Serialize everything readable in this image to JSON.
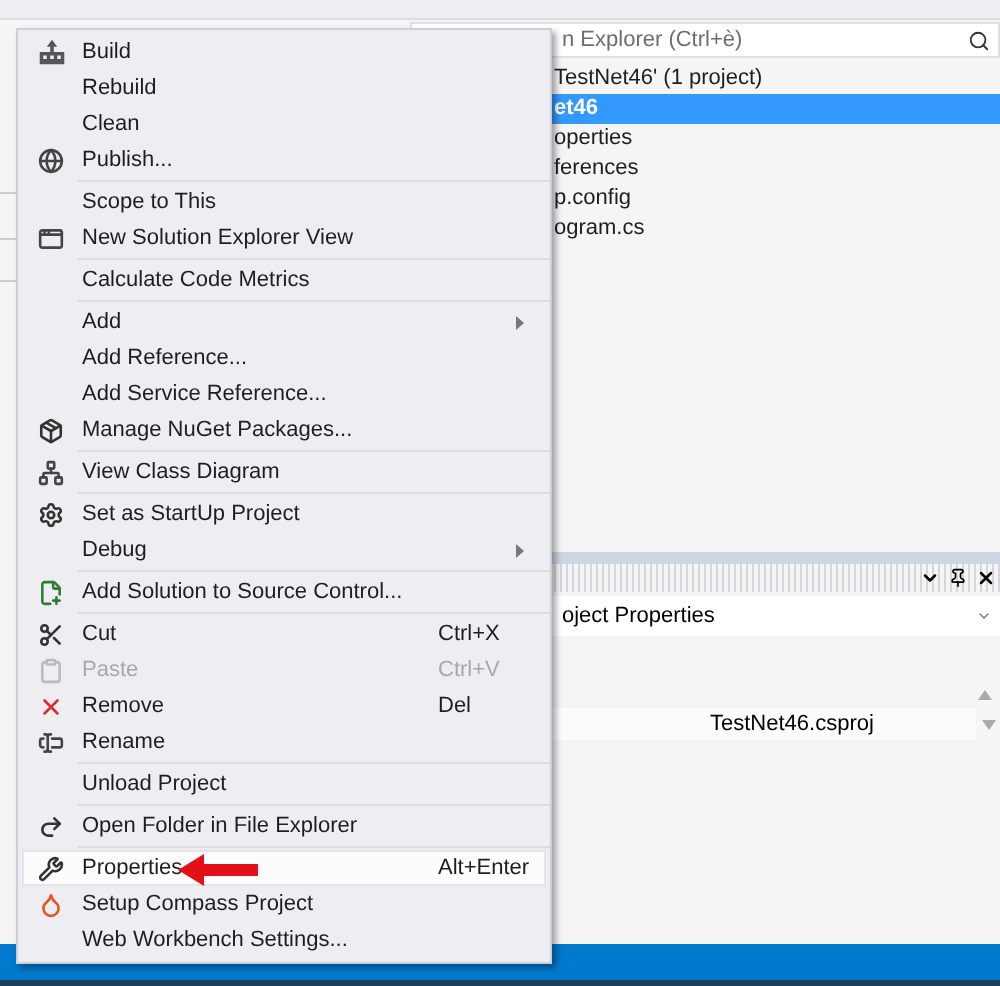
{
  "solution_explorer": {
    "search": {
      "placeholder": "n Explorer (Ctrl+è)"
    },
    "tree": [
      {
        "label": "TestNet46' (1 project)",
        "selected": false
      },
      {
        "label": "et46",
        "selected": true
      },
      {
        "label": "operties",
        "selected": false
      },
      {
        "label": "ferences",
        "selected": false
      },
      {
        "label": "p.config",
        "selected": false
      },
      {
        "label": "ogram.cs",
        "selected": false
      }
    ]
  },
  "properties_panel": {
    "object": "oject Properties",
    "rows": [
      {
        "value": "TestNet46.csproj"
      }
    ]
  },
  "context_menu": {
    "groups": [
      [
        {
          "label": "Build",
          "selected": false,
          "disabled": false,
          "submenu": false
        },
        {
          "label": "Rebuild",
          "selected": false,
          "disabled": false,
          "submenu": false
        },
        {
          "label": "Clean",
          "selected": false,
          "disabled": false,
          "submenu": false
        },
        {
          "label": "Publish...",
          "selected": false,
          "disabled": false,
          "submenu": false
        }
      ],
      [
        {
          "label": "Scope to This",
          "selected": false,
          "disabled": false,
          "submenu": false
        },
        {
          "label": "New Solution Explorer View",
          "selected": false,
          "disabled": false,
          "submenu": false
        }
      ],
      [
        {
          "label": "Calculate Code Metrics",
          "selected": false,
          "disabled": false,
          "submenu": false
        }
      ],
      [
        {
          "label": "Add",
          "selected": false,
          "disabled": false,
          "submenu": true
        },
        {
          "label": "Add Reference...",
          "selected": false,
          "disabled": false,
          "submenu": false
        },
        {
          "label": "Add Service Reference...",
          "selected": false,
          "disabled": false,
          "submenu": false
        },
        {
          "label": "Manage NuGet Packages...",
          "selected": false,
          "disabled": false,
          "submenu": false
        }
      ],
      [
        {
          "label": "View Class Diagram",
          "selected": false,
          "disabled": false,
          "submenu": false
        }
      ],
      [
        {
          "label": "Set as StartUp Project",
          "selected": false,
          "disabled": false,
          "submenu": false
        },
        {
          "label": "Debug",
          "selected": false,
          "disabled": false,
          "submenu": true
        }
      ],
      [
        {
          "label": "Add Solution to Source Control...",
          "selected": false,
          "disabled": false,
          "submenu": false
        }
      ],
      [
        {
          "label": "Cut",
          "shortcut": "Ctrl+X",
          "selected": false,
          "disabled": false,
          "submenu": false
        },
        {
          "label": "Paste",
          "shortcut": "Ctrl+V",
          "selected": false,
          "disabled": true,
          "submenu": false
        },
        {
          "label": "Remove",
          "shortcut": "Del",
          "selected": false,
          "disabled": false,
          "submenu": false
        },
        {
          "label": "Rename",
          "selected": false,
          "disabled": false,
          "submenu": false
        }
      ],
      [
        {
          "label": "Unload Project",
          "selected": false,
          "disabled": false,
          "submenu": false
        }
      ],
      [
        {
          "label": "Open Folder in File Explorer",
          "selected": false,
          "disabled": false,
          "submenu": false
        }
      ],
      [
        {
          "label": "Properties",
          "shortcut": "Alt+Enter",
          "selected": true,
          "disabled": false,
          "submenu": false
        },
        {
          "label": "Setup Compass Project",
          "selected": false,
          "disabled": false,
          "submenu": false
        },
        {
          "label": "Web Workbench Settings...",
          "selected": false,
          "disabled": false,
          "submenu": false
        }
      ]
    ]
  }
}
